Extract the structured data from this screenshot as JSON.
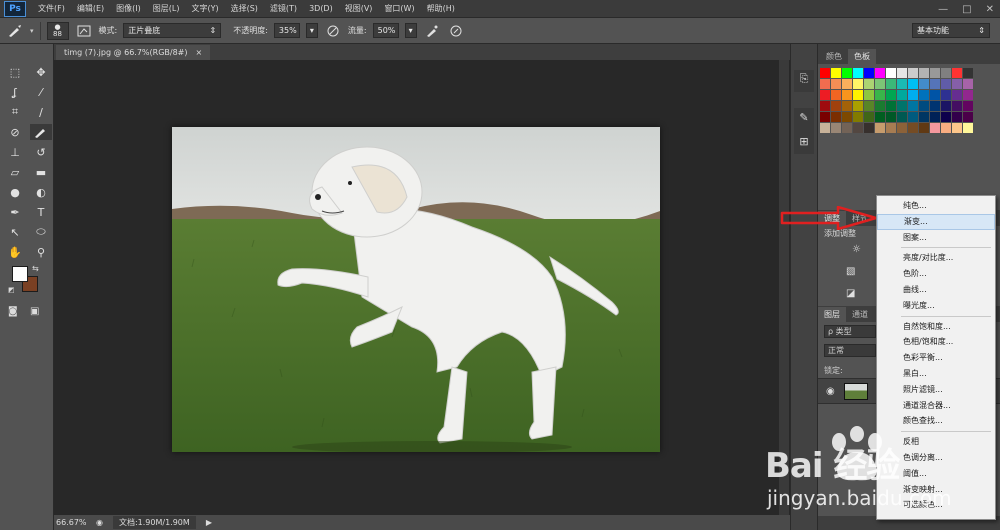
{
  "app": {
    "logo": "Ps"
  },
  "menubar": {
    "items": [
      "文件(F)",
      "编辑(E)",
      "图像(I)",
      "图层(L)",
      "文字(Y)",
      "选择(S)",
      "滤镜(T)",
      "3D(D)",
      "视图(V)",
      "窗口(W)",
      "帮助(H)"
    ],
    "window_controls": [
      "—",
      "□",
      "✕"
    ]
  },
  "options": {
    "brush_size": "88",
    "mode_label": "模式:",
    "mode_value": "正片叠底",
    "opacity_label": "不透明度:",
    "opacity_value": "35%",
    "flow_label": "流量:",
    "flow_value": "50%",
    "workspace": "基本功能"
  },
  "document": {
    "tab_title": "timg (7).jpg @ 66.7%(RGB/8#)",
    "close": "×",
    "zoom": "66.67%",
    "doc_info": "文档:1.90M/1.90M"
  },
  "colors": {
    "foreground": "#ffffff",
    "background": "#7a4023",
    "accent_red": "#e02020"
  },
  "panels": {
    "color_tabs": [
      "颜色",
      "色板"
    ],
    "adjust_tabs": [
      "调整",
      "样式"
    ],
    "adjust_add": "添加调整",
    "layers_tabs": [
      "图层",
      "通道"
    ],
    "layers_filter": "ρ 类型",
    "layers_mode": "正常",
    "layers_lock": "锁定:"
  },
  "menu": {
    "items": [
      "纯色...",
      "渐变...",
      "图案...",
      "亮度/对比度...",
      "色阶...",
      "曲线...",
      "曝光度...",
      "自然饱和度...",
      "色相/饱和度...",
      "色彩平衡...",
      "黑白...",
      "照片滤镜...",
      "通道混合器...",
      "颜色查找...",
      "反相",
      "色调分离...",
      "阈值...",
      "渐变映射...",
      "可选颜色..."
    ],
    "highlighted": "渐变..."
  },
  "watermark": {
    "brand": "Bai 经验",
    "url": "jingyan.baidu.com"
  }
}
